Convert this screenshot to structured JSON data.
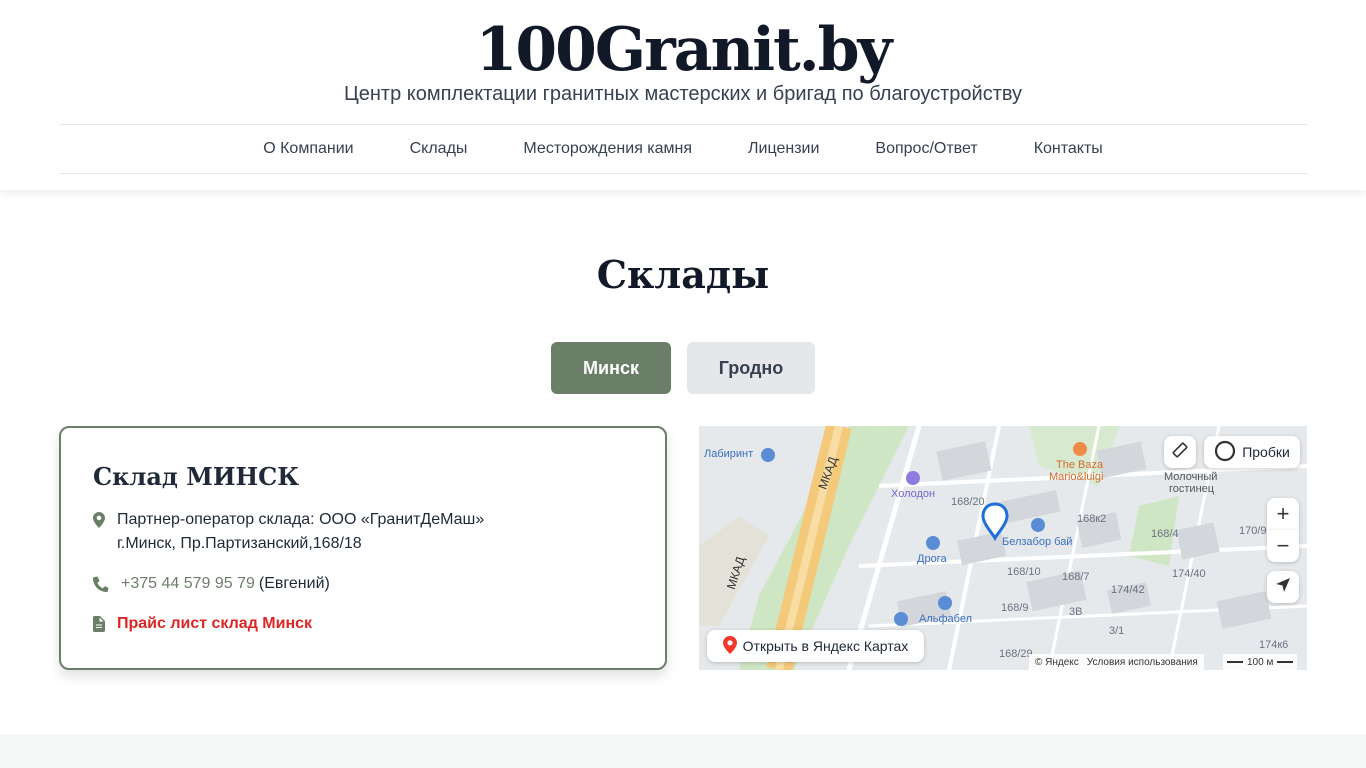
{
  "header": {
    "logo": "100Granit.by",
    "tagline": "Центр комплектации гранитных мастерских и бригад по благоустройству"
  },
  "nav": {
    "items": [
      "О Компании",
      "Склады",
      "Месторождения камня",
      "Лицензии",
      "Вопрос/Ответ",
      "Контакты"
    ]
  },
  "section": {
    "title": "Склады",
    "tabs": [
      {
        "label": "Минск",
        "active": true
      },
      {
        "label": "Гродно",
        "active": false
      }
    ]
  },
  "card": {
    "title": "Склад МИНСК",
    "address_line1": "Партнер-оператор склада: ООО «ГранитДеМаш»",
    "address_line2": "г.Минск, Пр.Партизанский,168/18",
    "phone": "+375 44 579 95 79",
    "contact_name": "(Евгений)",
    "price_link": "Прайс лист склад Минск",
    "accent_color": "#6b7f68",
    "link_color": "#dc2626"
  },
  "map": {
    "traffic_label": "Пробки",
    "open_label": "Открыть в Яндекс Картах",
    "zoom_in": "+",
    "zoom_out": "−",
    "copyright": "© Яндекс",
    "terms": "Условия использования",
    "scale": "100 м",
    "road_label_1": "МКАД",
    "road_label_2": "МКАД",
    "places": {
      "labirint": "Лабиринт",
      "holodon": "Холодон",
      "baza_1": "The Baza",
      "baza_2": "Mario&luigi",
      "molochny_1": "Молочный",
      "molochny_2": "гостинец",
      "belzabor": "Белзабор бай",
      "droga": "Дрога",
      "alfabel": "Альфабел"
    },
    "house_numbers": [
      "168/20",
      "168к2",
      "168/4",
      "170/9",
      "168/10",
      "168/7",
      "174/40",
      "174/42",
      "168/9",
      "3В",
      "3/1",
      "168/29",
      "174к6"
    ]
  }
}
